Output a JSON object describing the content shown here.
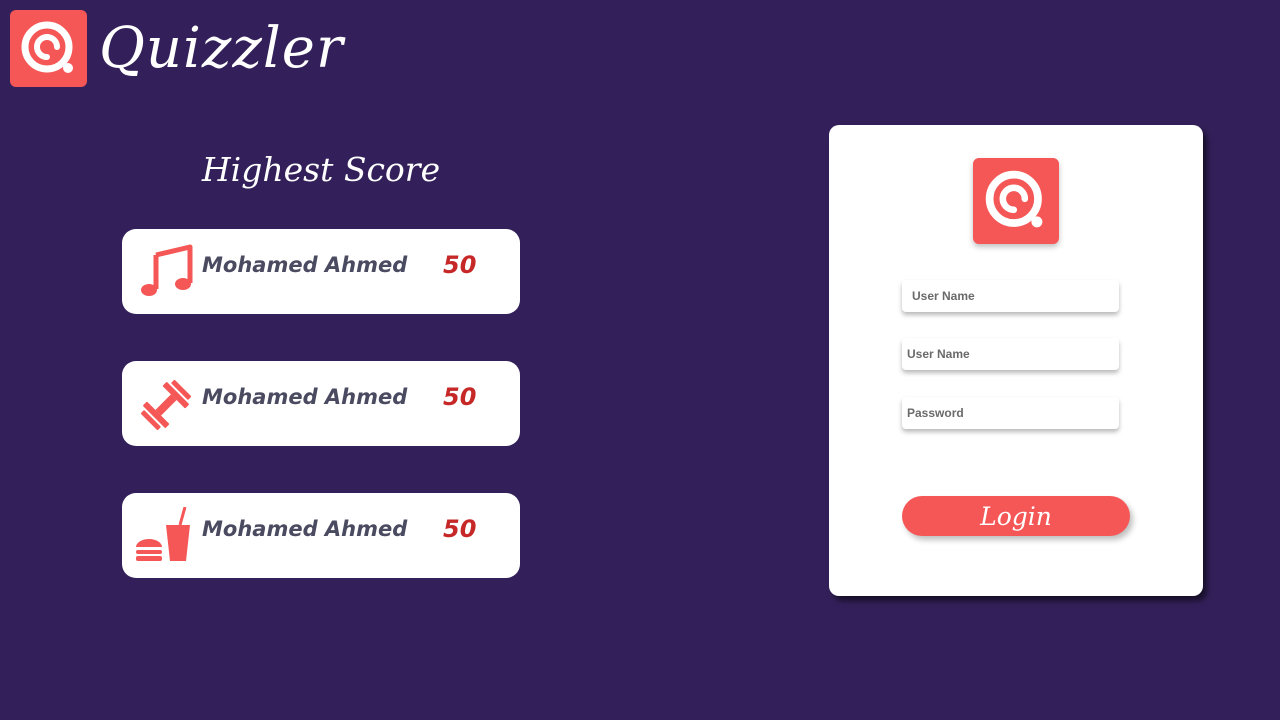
{
  "app": {
    "name": "Quizzler",
    "logo_icon": "quiz-q-logo-icon",
    "accent_color": "#f55656",
    "background_color": "#33205a"
  },
  "scores": {
    "title": "Highest Score",
    "entries": [
      {
        "category_icon": "music-note-icon",
        "player": "Mohamed Ahmed",
        "score": "50"
      },
      {
        "category_icon": "dumbbell-icon",
        "player": "Mohamed Ahmed",
        "score": "50"
      },
      {
        "category_icon": "fast-food-icon",
        "player": "Mohamed Ahmed",
        "score": "50"
      }
    ]
  },
  "login": {
    "field_1_placeholder": "User Name",
    "field_2_placeholder": "User Name",
    "password_placeholder": "Password",
    "button_label": "Login"
  }
}
